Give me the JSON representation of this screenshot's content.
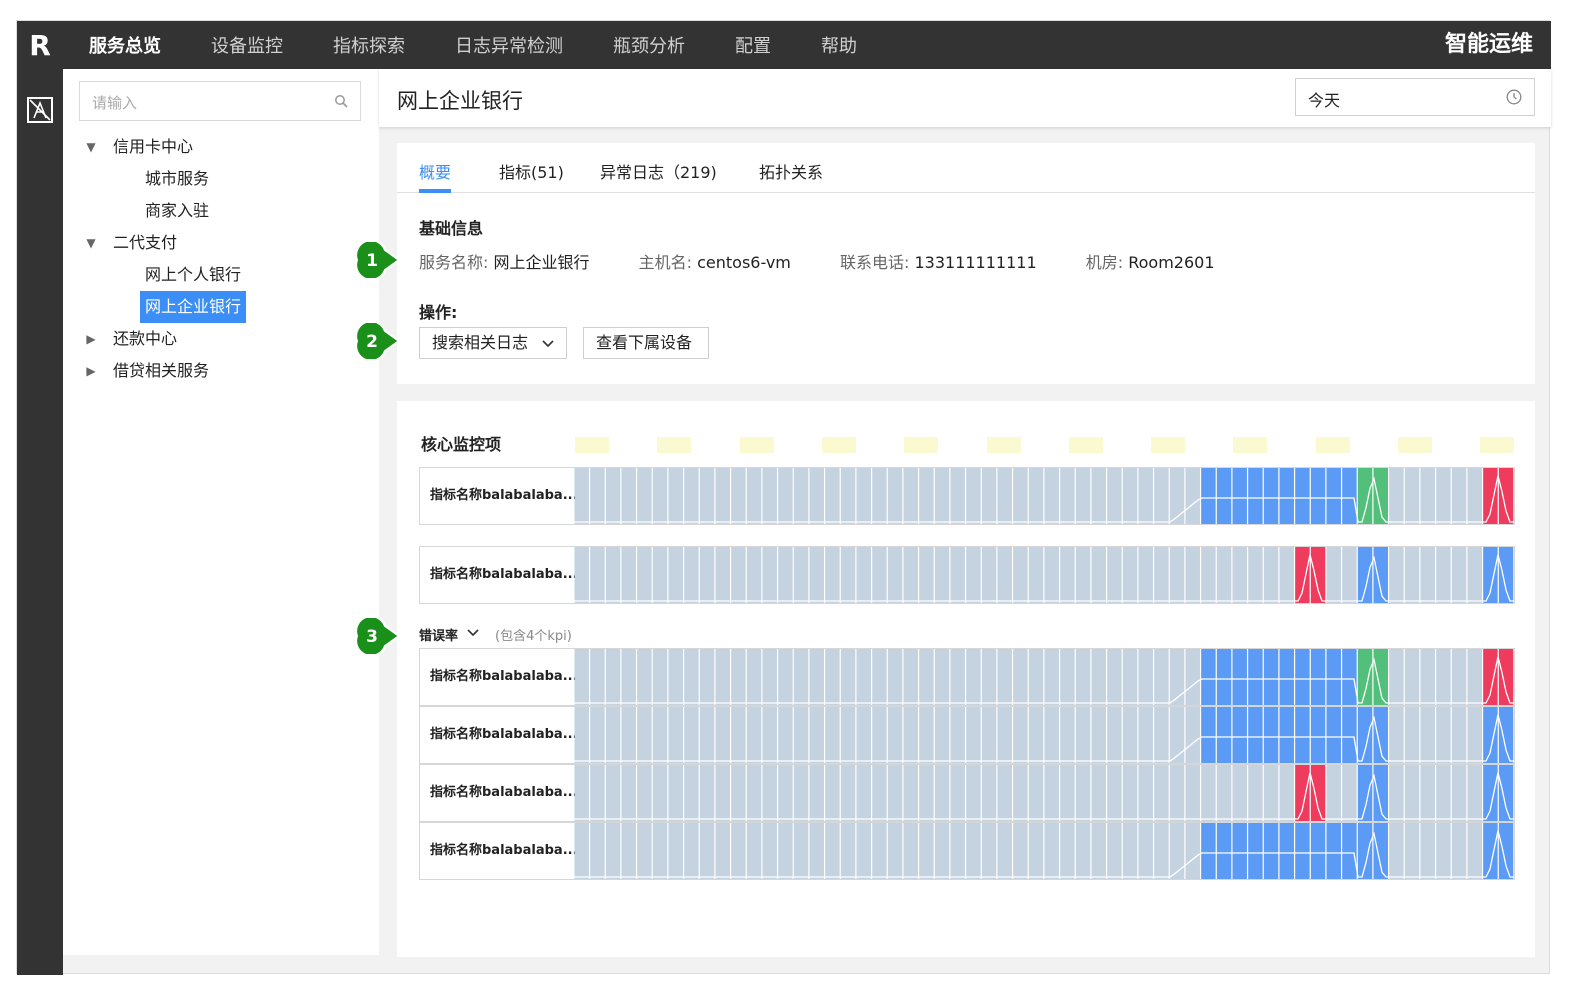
{
  "app": {
    "logo": "R",
    "brand": "智能运维"
  },
  "nav": [
    {
      "label": "服务总览",
      "active": true
    },
    {
      "label": "设备监控",
      "active": false
    },
    {
      "label": "指标探索",
      "active": false
    },
    {
      "label": "日志异常检测",
      "active": false
    },
    {
      "label": "瓶颈分析",
      "active": false
    },
    {
      "label": "配置",
      "active": false
    },
    {
      "label": "帮助",
      "active": false
    }
  ],
  "sidebar": {
    "search_placeholder": "请输入",
    "tree": [
      {
        "label": "信用卡中心",
        "level": 0,
        "expanded": true
      },
      {
        "label": "城市服务",
        "level": 1
      },
      {
        "label": "商家入驻",
        "level": 1
      },
      {
        "label": "二代支付",
        "level": 0,
        "expanded": true
      },
      {
        "label": "网上个人银行",
        "level": 1
      },
      {
        "label": "网上企业银行",
        "level": 1,
        "selected": true
      },
      {
        "label": "还款中心",
        "level": 0,
        "expanded": false
      },
      {
        "label": "借贷相关服务",
        "level": 0,
        "expanded": false
      }
    ]
  },
  "header": {
    "title": "网上企业银行",
    "date": "今天"
  },
  "tabs": [
    {
      "label": "概要",
      "active": true
    },
    {
      "label": "指标(51)",
      "active": false
    },
    {
      "label": "异常日志（219)",
      "active": false
    },
    {
      "label": "拓扑关系",
      "active": false
    }
  ],
  "basic": {
    "title": "基础信息",
    "fields": [
      {
        "label": "服务名称:",
        "value": "网上企业银行"
      },
      {
        "label": "主机名:",
        "value": "centos6-vm"
      },
      {
        "label": "联系电话:",
        "value": "133111111111"
      },
      {
        "label": "机房:",
        "value": "Room2601"
      }
    ],
    "ops_title": "操作:",
    "ops": {
      "search_logs": "搜索相关日志",
      "view_devices": "查看下属设备"
    }
  },
  "badges": [
    "1",
    "2",
    "3"
  ],
  "core": {
    "title": "核心监控项",
    "rows": [
      {
        "label": "指标名称balabalaba...",
        "highlights": [
          {
            "from": 20,
            "to": 24,
            "color": "blue"
          },
          {
            "from": 25,
            "to": 25,
            "color": "green"
          },
          {
            "from": 29,
            "to": 29,
            "color": "red"
          }
        ]
      },
      {
        "label": "指标名称balabalaba...",
        "highlights": [
          {
            "from": 23,
            "to": 23,
            "color": "red"
          },
          {
            "from": 25,
            "to": 25,
            "color": "blue"
          },
          {
            "from": 29,
            "to": 29,
            "color": "blue"
          }
        ]
      }
    ],
    "group": {
      "label": "错误率",
      "note": "(包含4个kpi)",
      "rows": [
        {
          "label": "指标名称balabalaba...",
          "highlights": [
            {
              "from": 20,
              "to": 24,
              "color": "blue"
            },
            {
              "from": 25,
              "to": 25,
              "color": "green"
            },
            {
              "from": 29,
              "to": 29,
              "color": "red"
            }
          ]
        },
        {
          "label": "指标名称balabalaba...",
          "highlights": [
            {
              "from": 20,
              "to": 24,
              "color": "blue"
            },
            {
              "from": 25,
              "to": 25,
              "color": "blue"
            },
            {
              "from": 29,
              "to": 29,
              "color": "blue"
            }
          ]
        },
        {
          "label": "指标名称balabalaba...",
          "highlights": [
            {
              "from": 23,
              "to": 23,
              "color": "red"
            },
            {
              "from": 25,
              "to": 25,
              "color": "blue"
            },
            {
              "from": 29,
              "to": 29,
              "color": "blue"
            }
          ]
        },
        {
          "label": "指标名称balabalaba...",
          "highlights": [
            {
              "from": 20,
              "to": 24,
              "color": "blue"
            },
            {
              "from": 25,
              "to": 25,
              "color": "blue"
            },
            {
              "from": 29,
              "to": 29,
              "color": "blue"
            }
          ]
        }
      ]
    }
  },
  "colors": {
    "cell": "#c5d2e0",
    "blue": "#5b9bf5",
    "green": "#52c07a",
    "red": "#ef3b5d",
    "legend": "#fbf9d0",
    "accent": "#3a8ef6",
    "badge": "#1a8f1a"
  }
}
